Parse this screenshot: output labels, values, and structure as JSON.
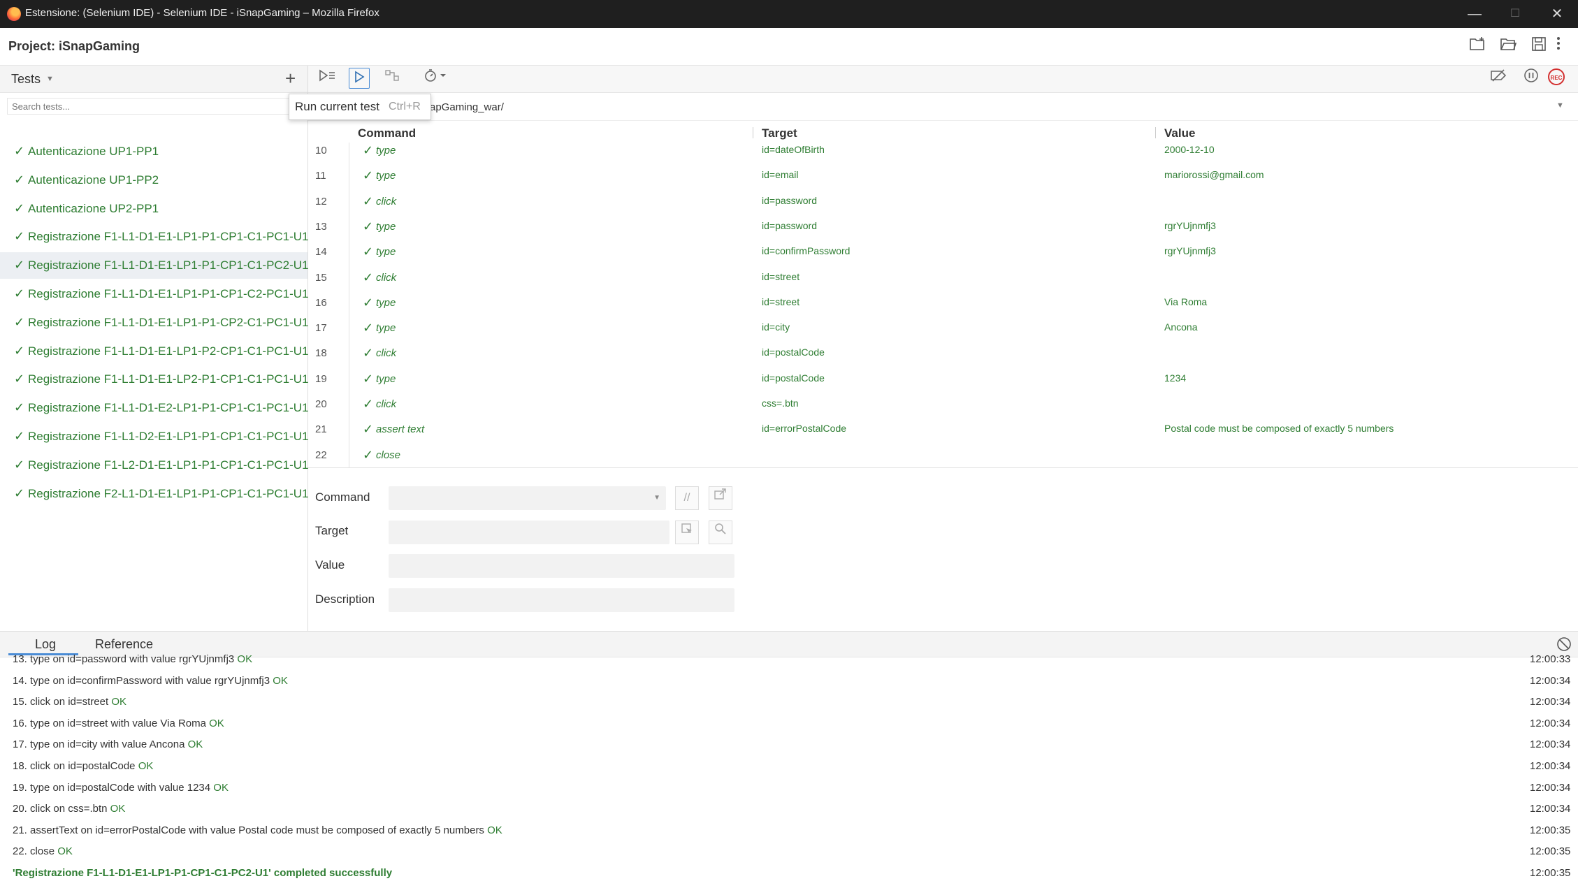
{
  "window": {
    "title": "Estensione: (Selenium IDE) - Selenium IDE - iSnapGaming – Mozilla Firefox",
    "minimize": "—",
    "maximize": "☐",
    "close": "✕"
  },
  "project": {
    "label": "Project:  iSnapGaming"
  },
  "sidebar": {
    "header": "Tests",
    "search_placeholder": "Search tests...",
    "items": [
      {
        "label": "Autenticazione UP1-PP1",
        "status": "✓"
      },
      {
        "label": "Autenticazione UP1-PP2",
        "status": "✓"
      },
      {
        "label": "Autenticazione UP2-PP1",
        "status": "✓"
      },
      {
        "label": "Registrazione F1-L1-D1-E1-LP1-P1-CP1-C1-PC1-U1",
        "status": "✓"
      },
      {
        "label": "Registrazione F1-L1-D1-E1-LP1-P1-CP1-C1-PC2-U1",
        "status": "✓"
      },
      {
        "label": "Registrazione F1-L1-D1-E1-LP1-P1-CP1-C2-PC1-U1",
        "status": "✓"
      },
      {
        "label": "Registrazione F1-L1-D1-E1-LP1-P1-CP2-C1-PC1-U1",
        "status": "✓"
      },
      {
        "label": "Registrazione F1-L1-D1-E1-LP1-P2-CP1-C1-PC1-U1",
        "status": "✓"
      },
      {
        "label": "Registrazione F1-L1-D1-E1-LP2-P1-CP1-C1-PC1-U1",
        "status": "✓"
      },
      {
        "label": "Registrazione F1-L1-D1-E2-LP1-P1-CP1-C1-PC1-U1",
        "status": "✓"
      },
      {
        "label": "Registrazione F1-L1-D2-E1-LP1-P1-CP1-C1-PC1-U1",
        "status": "✓"
      },
      {
        "label": "Registrazione F1-L2-D1-E1-LP1-P1-CP1-C1-PC1-U1",
        "status": "✓"
      },
      {
        "label": "Registrazione F2-L1-D1-E1-LP1-P1-CP1-C1-PC1-U1",
        "status": "✓"
      }
    ]
  },
  "tooltip": {
    "label": "Run current test",
    "shortcut": "Ctrl+R"
  },
  "url": {
    "value": "apGaming_war/"
  },
  "table": {
    "headers": {
      "command": "Command",
      "target": "Target",
      "value": "Value"
    },
    "rows": [
      {
        "num": "10",
        "status": "✓",
        "command": "type",
        "target": "id=dateOfBirth",
        "value": "2000-12-10"
      },
      {
        "num": "11",
        "status": "✓",
        "command": "type",
        "target": "id=email",
        "value": "mariorossi@gmail.com"
      },
      {
        "num": "12",
        "status": "✓",
        "command": "click",
        "target": "id=password",
        "value": ""
      },
      {
        "num": "13",
        "status": "✓",
        "command": "type",
        "target": "id=password",
        "value": "rgrYUjnmfj3"
      },
      {
        "num": "14",
        "status": "✓",
        "command": "type",
        "target": "id=confirmPassword",
        "value": "rgrYUjnmfj3"
      },
      {
        "num": "15",
        "status": "✓",
        "command": "click",
        "target": "id=street",
        "value": ""
      },
      {
        "num": "16",
        "status": "✓",
        "command": "type",
        "target": "id=street",
        "value": "Via Roma"
      },
      {
        "num": "17",
        "status": "✓",
        "command": "type",
        "target": "id=city",
        "value": "Ancona"
      },
      {
        "num": "18",
        "status": "✓",
        "command": "click",
        "target": "id=postalCode",
        "value": ""
      },
      {
        "num": "19",
        "status": "✓",
        "command": "type",
        "target": "id=postalCode",
        "value": "1234"
      },
      {
        "num": "20",
        "status": "✓",
        "command": "click",
        "target": "css=.btn",
        "value": ""
      },
      {
        "num": "21",
        "status": "✓",
        "command": "assert text",
        "target": "id=errorPostalCode",
        "value": "Postal code must be composed of exactly 5 numbers"
      },
      {
        "num": "22",
        "status": "✓",
        "command": "close",
        "target": "",
        "value": ""
      }
    ]
  },
  "editor": {
    "command_label": "Command",
    "target_label": "Target",
    "value_label": "Value",
    "description_label": "Description",
    "comment_glyph": "//"
  },
  "log": {
    "tabs": [
      "Log",
      "Reference"
    ],
    "lines": [
      {
        "msg": "13. type on id=password with value rgrYUjnmfj3",
        "ok": "OK",
        "time": "12:00:33"
      },
      {
        "msg": "14. type on id=confirmPassword with value rgrYUjnmfj3",
        "ok": "OK",
        "time": "12:00:34"
      },
      {
        "msg": "15. click on id=street",
        "ok": "OK",
        "time": "12:00:34"
      },
      {
        "msg": "16. type on id=street with value Via Roma",
        "ok": "OK",
        "time": "12:00:34"
      },
      {
        "msg": "17. type on id=city with value Ancona",
        "ok": "OK",
        "time": "12:00:34"
      },
      {
        "msg": "18. click on id=postalCode",
        "ok": "OK",
        "time": "12:00:34"
      },
      {
        "msg": "19. type on id=postalCode with value 1234",
        "ok": "OK",
        "time": "12:00:34"
      },
      {
        "msg": "20. click on css=.btn",
        "ok": "OK",
        "time": "12:00:34"
      },
      {
        "msg": "21. assertText on id=errorPostalCode with value Postal code must be composed of exactly 5 numbers",
        "ok": "OK",
        "time": "12:00:35"
      },
      {
        "msg": "22. close",
        "ok": "OK",
        "time": "12:00:35"
      }
    ],
    "final": {
      "msg": "'Registrazione F1-L1-D1-E1-LP1-P1-CP1-C1-PC2-U1' completed successfully",
      "time": "12:00:35"
    }
  },
  "colors": {
    "success": "#2e7d32",
    "accent": "#4a8cd6",
    "record": "#d32f2f"
  }
}
